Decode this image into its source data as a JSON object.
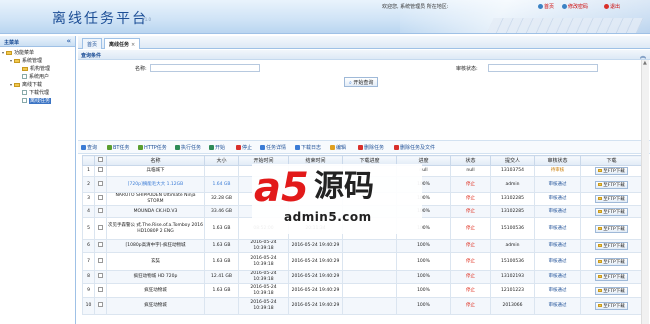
{
  "header": {
    "title": "离线任务平台",
    "version": "V1.0",
    "user_text": "欢迎您, 系统管理员  所在地区:",
    "home_link": "首页",
    "change_pwd_link": "修改密码",
    "logout_link": "退出"
  },
  "sidebar": {
    "title": "主菜单",
    "collapse": "«",
    "tree": [
      {
        "label": "功能菜单",
        "level": 0
      },
      {
        "label": "系统管理",
        "level": 1
      },
      {
        "label": "机构管理",
        "level": 2
      },
      {
        "label": "系统用户",
        "level": 2
      },
      {
        "label": "离线下载",
        "level": 1
      },
      {
        "label": "下载代理",
        "level": 2
      },
      {
        "label": "离线任务",
        "level": 2,
        "selected": true
      }
    ]
  },
  "tabs": [
    {
      "label": "首页"
    },
    {
      "label": "离线任务",
      "active": true,
      "close": "×"
    }
  ],
  "query": {
    "title": "查询条件",
    "name_label": "名称:",
    "status_label": "审核状态:",
    "submit": "开始查询"
  },
  "toolbar": [
    {
      "label": "查询",
      "color": "#3a7bd5"
    },
    {
      "label": "BT任务",
      "color": "#5a9e2f"
    },
    {
      "label": "HTTP任务",
      "color": "#5a9e2f"
    },
    {
      "label": "执行任务",
      "color": "#2e8b57"
    },
    {
      "label": "开始",
      "color": "#2e8b57"
    },
    {
      "label": "停止",
      "color": "#d9302a"
    },
    {
      "label": "任务详情",
      "color": "#3a7bd5"
    },
    {
      "label": "下载日志",
      "color": "#3a7bd5"
    },
    {
      "label": "编辑",
      "color": "#e0a020"
    },
    {
      "label": "删除任务",
      "color": "#d9302a"
    },
    {
      "label": "删除任务及文件",
      "color": "#d9302a"
    }
  ],
  "table": {
    "columns": [
      "",
      "",
      "名称",
      "大小",
      "开始时间",
      "结束时间",
      "下载进度",
      "进度",
      "状态",
      "提交人",
      "审核状态",
      "下载"
    ],
    "rows": [
      {
        "idx": "1",
        "name": "兵临城下",
        "size": "",
        "start": "",
        "end": "",
        "speed": "",
        "progress": "null",
        "status": "null",
        "submitter": "13103754",
        "review": "待审核",
        "review_type": "wait",
        "download": "至FTP下载"
      },
      {
        "idx": "2",
        "name": "[720p]摘能毛大大 1.12GB",
        "size": "1.64 GB",
        "start": "",
        "end": "",
        "speed": "",
        "progress": "100%",
        "status": "停止",
        "submitter": "admin",
        "review": "审核通过",
        "review_type": "pass",
        "download": "至FTP下载"
      },
      {
        "idx": "3",
        "name": "NARUTO SHIPPUDEN Ultimate Ninja STORM",
        "size": "32.28 GB",
        "start": "",
        "end": "",
        "speed": "",
        "progress": "100%",
        "status": "停止",
        "submitter": "13102285",
        "review": "审核通过",
        "review_type": "pass",
        "download": "至FTP下载"
      },
      {
        "idx": "4",
        "name": "MOUNDA CK.HD.V3",
        "size": "33.46 GB",
        "start": "",
        "end": "",
        "speed": "",
        "progress": "100%",
        "status": "停止",
        "submitter": "13102285",
        "review": "审核通过",
        "review_type": "pass",
        "download": "至FTP下载"
      },
      {
        "idx": "5",
        "name": "次见手森警公 式.The.Rise.of.a.Tomboy 2016 HD1080P 2 ENG",
        "size": "1.63 GB",
        "start": "08:52:00",
        "end": "20:11:34",
        "speed": "",
        "progress": "100%",
        "status": "停止",
        "submitter": "15100536",
        "review": "审核通过",
        "review_type": "pass",
        "download": "至FTP下载"
      },
      {
        "idx": "6",
        "name": "[1080p高清中字]-疯狂动物城",
        "size": "1.63 GB",
        "start": "2016-05-24 10:39:18",
        "end": "2016-05-24 19:40:29",
        "speed": "",
        "progress": "100%",
        "status": "停止",
        "submitter": "admin",
        "review": "审核通过",
        "review_type": "pass",
        "download": "至FTP下载"
      },
      {
        "idx": "7",
        "name": "玄奘",
        "size": "1.63 GB",
        "start": "2016-05-24 10:39:18",
        "end": "2016-05-24 19:40:29",
        "speed": "",
        "progress": "100%",
        "status": "停止",
        "submitter": "15100536",
        "review": "审核通过",
        "review_type": "pass",
        "download": "至FTP下载"
      },
      {
        "idx": "8",
        "name": "疯狂动物城 HD 720p",
        "size": "12.41 GB",
        "start": "2016-05-24 10:39:18",
        "end": "2016-05-24 19:40:29",
        "speed": "",
        "progress": "100%",
        "status": "停止",
        "submitter": "13102193",
        "review": "审核通过",
        "review_type": "pass",
        "download": "至FTP下载"
      },
      {
        "idx": "9",
        "name": "疯狂动物城",
        "size": "1.63 GB",
        "start": "2016-05-24 10:39:18",
        "end": "2016-05-24 19:40:29",
        "speed": "",
        "progress": "100%",
        "status": "停止",
        "submitter": "12101223",
        "review": "审核通过",
        "review_type": "pass",
        "download": "至FTP下载"
      },
      {
        "idx": "10",
        "name": "疯狂动物城",
        "size": "",
        "start": "2016-05-24 10:39:18",
        "end": "2016-05-24 19:40:29",
        "speed": "",
        "progress": "100%",
        "status": "停止",
        "submitter": "2013066",
        "review": "审核通过",
        "review_type": "pass",
        "download": "至FTP下载"
      }
    ]
  },
  "watermark": {
    "logo": "a5",
    "name": "源码",
    "url": "admin5.com"
  },
  "colors": {
    "accent": "#1c4e96",
    "header_bg": "#cfe3f6",
    "stop": "#d21",
    "pending": "#c87a00"
  }
}
